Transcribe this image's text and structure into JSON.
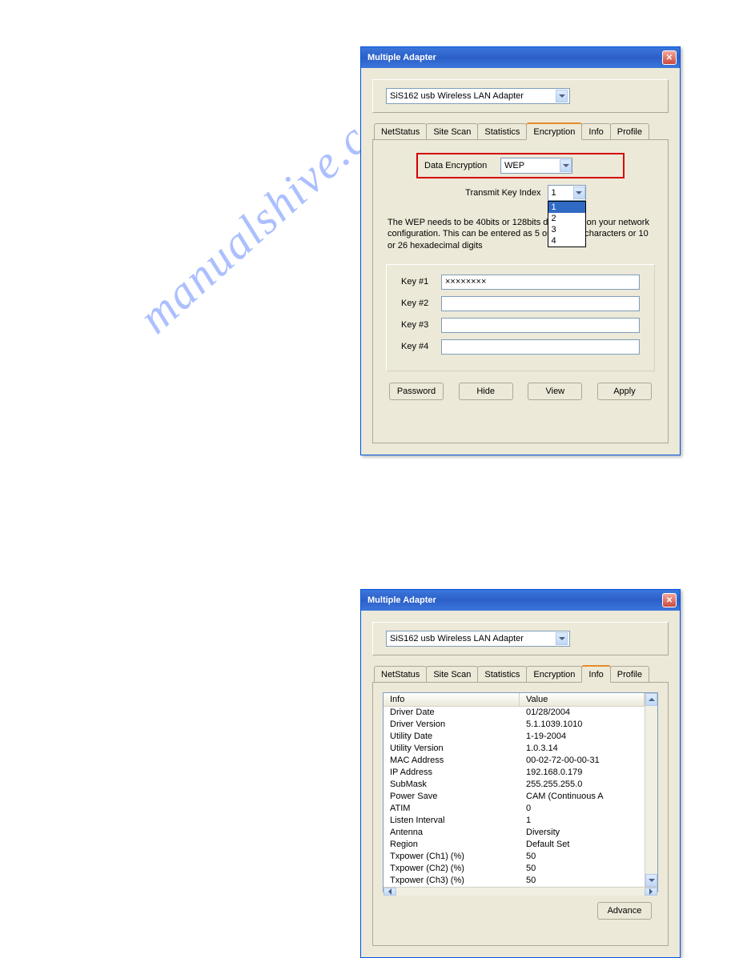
{
  "watermark": "manualshive.com",
  "dialog1": {
    "title": "Multiple Adapter",
    "adapter": "SiS162 usb Wireless LAN Adapter",
    "tabs": [
      "NetStatus",
      "Site Scan",
      "Statistics",
      "Encryption",
      "Info",
      "Profile"
    ],
    "activeTab": "Encryption",
    "dataEncryptionLabel": "Data Encryption",
    "dataEncryptionValue": "WEP",
    "transmitKeyLabel": "Transmit Key Index",
    "transmitKeyValue": "1",
    "transmitKeyOptions": [
      "1",
      "2",
      "3",
      "4"
    ],
    "helpText": "The WEP needs to be 40bits or 128bits depending on your network configuration. This can be entered as 5 or 13 ascii characters or 10 or 26 hexadecimal digits",
    "keys": [
      {
        "label": "Key #1",
        "value": "××××××××"
      },
      {
        "label": "Key #2",
        "value": ""
      },
      {
        "label": "Key #3",
        "value": ""
      },
      {
        "label": "Key #4",
        "value": ""
      }
    ],
    "buttons": {
      "password": "Password",
      "hide": "Hide",
      "view": "View",
      "apply": "Apply"
    }
  },
  "dialog2": {
    "title": "Multiple Adapter",
    "adapter": "SiS162 usb Wireless LAN Adapter",
    "tabs": [
      "NetStatus",
      "Site Scan",
      "Statistics",
      "Encryption",
      "Info",
      "Profile"
    ],
    "activeTab": "Info",
    "headers": {
      "info": "Info",
      "value": "Value"
    },
    "rows": [
      {
        "info": "Driver Date",
        "value": "01/28/2004"
      },
      {
        "info": "Driver Version",
        "value": "5.1.1039.1010"
      },
      {
        "info": "Utility Date",
        "value": "1-19-2004"
      },
      {
        "info": "Utility Version",
        "value": "1.0.3.14"
      },
      {
        "info": "MAC Address",
        "value": "00-02-72-00-00-31"
      },
      {
        "info": "IP Address",
        "value": "192.168.0.179"
      },
      {
        "info": "SubMask",
        "value": "255.255.255.0"
      },
      {
        "info": "Power Save",
        "value": "CAM (Continuous A"
      },
      {
        "info": "ATIM",
        "value": "0"
      },
      {
        "info": "Listen Interval",
        "value": "1"
      },
      {
        "info": "Antenna",
        "value": "Diversity"
      },
      {
        "info": "Region",
        "value": "Default Set"
      },
      {
        "info": "Txpower (Ch1) (%)",
        "value": "50"
      },
      {
        "info": "Txpower (Ch2) (%)",
        "value": "50"
      },
      {
        "info": "Txpower (Ch3) (%)",
        "value": "50"
      }
    ],
    "advanceBtn": "Advance"
  }
}
